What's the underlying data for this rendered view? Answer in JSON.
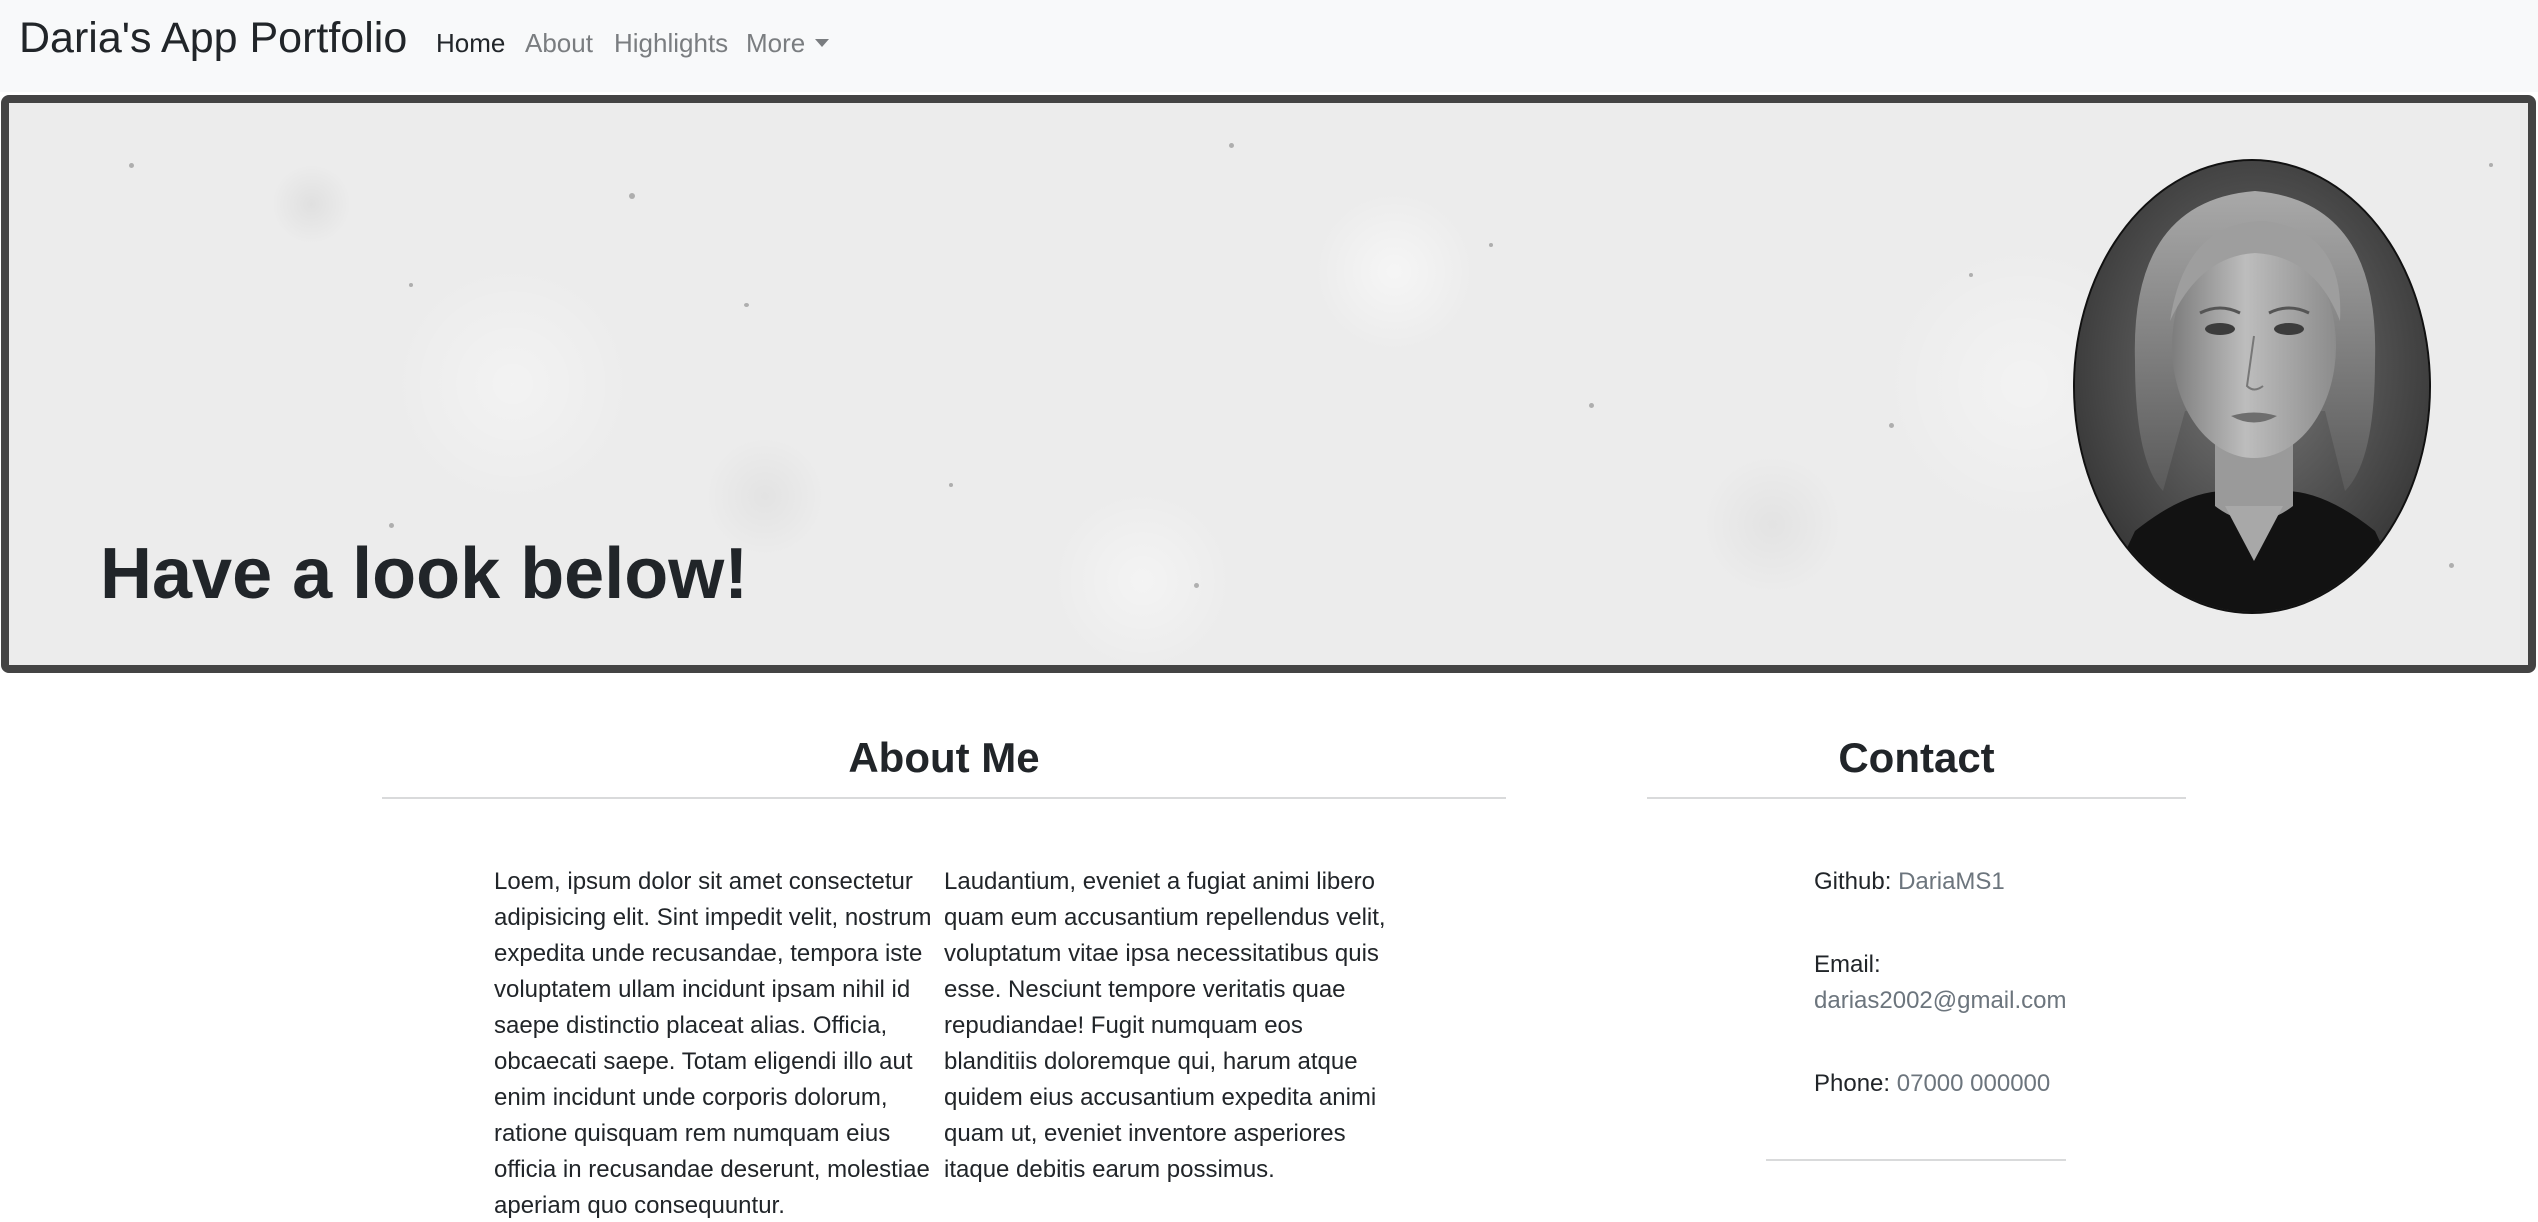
{
  "navbar": {
    "brand": "Daria's App Portfolio",
    "links": [
      {
        "label": "Home",
        "active": true
      },
      {
        "label": "About",
        "active": false
      },
      {
        "label": "Highlights",
        "active": false
      },
      {
        "label": "More",
        "active": false,
        "dropdown": true
      }
    ]
  },
  "hero": {
    "title": "Have a look below!",
    "border_color": "#444444",
    "background": "light grey concrete texture"
  },
  "about": {
    "heading": "About Me",
    "paragraphs": [
      "Loem, ipsum dolor sit amet consectetur adipisicing elit. Sint impedit velit, nostrum expedita unde recusandae, tempora iste voluptatem ullam incidunt ipsam nihil id saepe distinctio placeat alias. Officia, obcaecati saepe. Totam eligendi illo aut enim incidunt unde corporis dolorum, ratione quisquam rem numquam eius officia in recusandae deserunt, molestiae aperiam quo consequuntur.",
      "Laudantium, eveniet a fugiat animi libero quam eum accusantium repellendus velit, voluptatum vitae ipsa necessitatibus quis esse. Nesciunt tempore veritatis quae repudiandae! Fugit numquam eos blanditiis doloremque qui, harum atque quidem eius accusantium expedita animi quam ut, eveniet inventore asperiores itaque debitis earum possimus."
    ]
  },
  "contact": {
    "heading": "Contact",
    "github_label": "Github:",
    "github_value": "DariaMS1",
    "email_label": "Email:",
    "email_value": "darias2002@gmail.com",
    "phone_label": "Phone:",
    "phone_value": "07000 000000"
  },
  "colors": {
    "text": "#212529",
    "muted": "#6c757d",
    "navbar_bg": "#f8f9fa"
  }
}
